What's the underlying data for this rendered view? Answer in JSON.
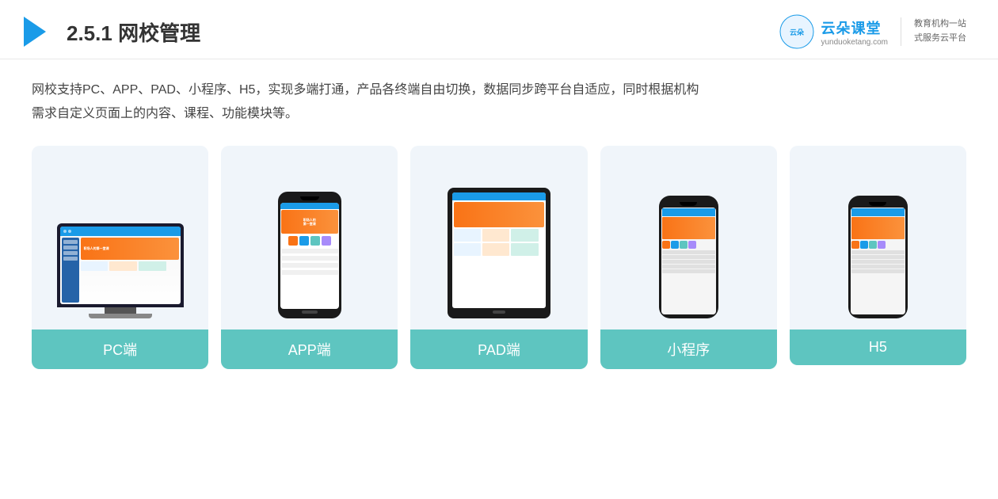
{
  "header": {
    "title_prefix": "2.5.1 ",
    "title_bold": "网校管理",
    "brand": {
      "name": "云朵课堂",
      "url": "yunduoketang.com",
      "slogan_line1": "教育机构一站",
      "slogan_line2": "式服务云平台"
    }
  },
  "description": {
    "line1": "网校支持PC、APP、PAD、小程序、H5，实现多端打通，产品各终端自由切换，数据同步跨平台自适应，同时根据机构",
    "line2": "需求自定义页面上的内容、课程、功能模块等。"
  },
  "cards": [
    {
      "id": "pc",
      "label": "PC端"
    },
    {
      "id": "app",
      "label": "APP端"
    },
    {
      "id": "pad",
      "label": "PAD端"
    },
    {
      "id": "miniprogram",
      "label": "小程序"
    },
    {
      "id": "h5",
      "label": "H5"
    }
  ]
}
